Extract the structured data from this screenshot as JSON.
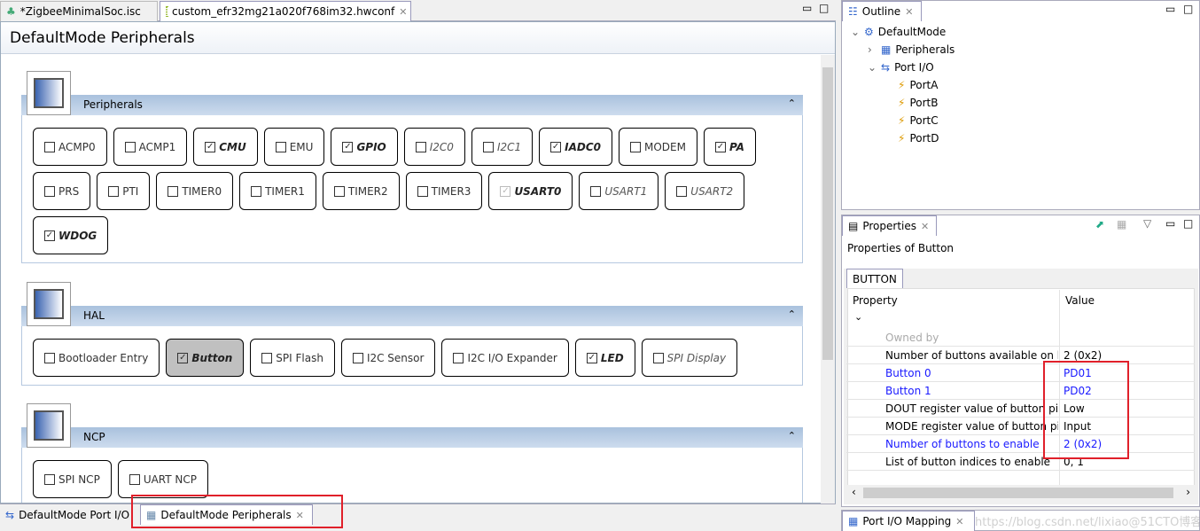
{
  "editor_tabs": [
    {
      "label": "*ZigbeeMinimalSoc.isc",
      "icon": "zigbee-icon"
    },
    {
      "label": "custom_efr32mg21a020f768im32.hwconf",
      "icon": "chip-icon",
      "active": true
    }
  ],
  "editor": {
    "title": "DefaultMode Peripherals",
    "sections": [
      {
        "title": "Peripherals",
        "rows": [
          [
            {
              "label": "ACMP0",
              "checked": false
            },
            {
              "label": "ACMP1",
              "checked": false
            },
            {
              "label": "CMU",
              "checked": true
            },
            {
              "label": "EMU",
              "checked": false
            },
            {
              "label": "GPIO",
              "checked": true
            },
            {
              "label": "I2C0",
              "checked": false,
              "italic": true
            },
            {
              "label": "I2C1",
              "checked": false,
              "italic": true
            },
            {
              "label": "IADC0",
              "checked": true
            },
            {
              "label": "MODEM",
              "checked": false
            },
            {
              "label": "PA",
              "checked": true
            }
          ],
          [
            {
              "label": "PRS",
              "checked": false
            },
            {
              "label": "PTI",
              "checked": false
            },
            {
              "label": "TIMER0",
              "checked": false
            },
            {
              "label": "TIMER1",
              "checked": false
            },
            {
              "label": "TIMER2",
              "checked": false
            },
            {
              "label": "TIMER3",
              "checked": false
            },
            {
              "label": "USART0",
              "checked": true,
              "disabled": true
            },
            {
              "label": "USART1",
              "checked": false,
              "italic": true
            },
            {
              "label": "USART2",
              "checked": false,
              "italic": true
            }
          ],
          [
            {
              "label": "WDOG",
              "checked": true
            }
          ]
        ]
      },
      {
        "title": "HAL",
        "rows": [
          [
            {
              "label": "Bootloader Entry",
              "checked": false
            },
            {
              "label": "Button",
              "checked": true,
              "selected": true
            },
            {
              "label": "SPI Flash",
              "checked": false
            },
            {
              "label": "I2C Sensor",
              "checked": false
            },
            {
              "label": "I2C I/O Expander",
              "checked": false
            },
            {
              "label": "LED",
              "checked": true
            },
            {
              "label": "SPI Display",
              "checked": false,
              "italic": true
            }
          ]
        ]
      },
      {
        "title": "NCP",
        "rows": [
          [
            {
              "label": "SPI NCP",
              "checked": false
            },
            {
              "label": "UART NCP",
              "checked": false
            }
          ]
        ]
      }
    ],
    "bottom_tabs": [
      {
        "label": "DefaultMode Port I/O",
        "icon": "port-io-icon"
      },
      {
        "label": "DefaultMode Peripherals",
        "icon": "peripherals-icon",
        "active": true
      }
    ]
  },
  "outline": {
    "title": "Outline",
    "tree": [
      {
        "label": "DefaultMode",
        "level": 0,
        "expanded": true
      },
      {
        "label": "Peripherals",
        "level": 1,
        "expanded": false
      },
      {
        "label": "Port I/O",
        "level": 1,
        "expanded": true
      },
      {
        "label": "PortA",
        "level": 2
      },
      {
        "label": "PortB",
        "level": 2
      },
      {
        "label": "PortC",
        "level": 2
      },
      {
        "label": "PortD",
        "level": 2
      }
    ]
  },
  "properties": {
    "title": "Properties",
    "subtitle": "Properties of Button",
    "tab": "BUTTON",
    "col_property": "Property",
    "col_value": "Value",
    "rows": [
      {
        "key": "Owned by",
        "value": "",
        "style": "gray"
      },
      {
        "key": "Number of buttons available on board",
        "value": "2 (0x2)",
        "style": "normal"
      },
      {
        "key": "Button 0",
        "value": "PD01",
        "style": "blue"
      },
      {
        "key": "Button 1",
        "value": "PD02",
        "style": "blue"
      },
      {
        "key": "DOUT register value of button pin",
        "value": "Low",
        "style": "normal"
      },
      {
        "key": "MODE register value of button pin",
        "value": "Input",
        "style": "normal"
      },
      {
        "key": "Number of buttons to enable",
        "value": "2 (0x2)",
        "style": "blue"
      },
      {
        "key": "List of button indices to enable",
        "value": "0, 1",
        "style": "normal"
      }
    ]
  },
  "port_io_mapping": {
    "title": "Port I/O Mapping"
  },
  "watermark": "https://blog.csdn.net/lixiao@51CTO博客",
  "colors": {
    "accent_blue": "#1a1aff",
    "highlight_red": "#e0202a",
    "section_bar": "#a9c1dd"
  }
}
